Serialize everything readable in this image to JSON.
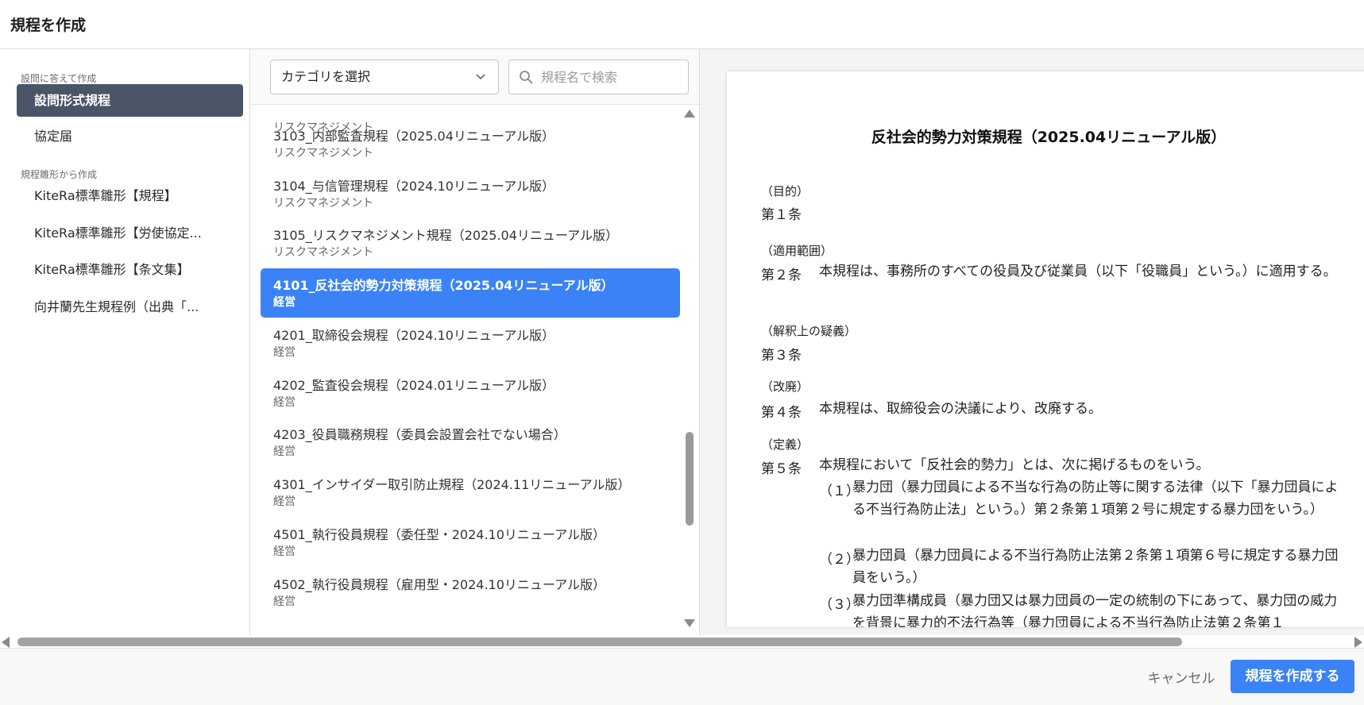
{
  "header": {
    "title": "規程を作成"
  },
  "sidebar": {
    "section_questionnaire": "設問に答えて作成",
    "section_template": "規程雛形から作成",
    "items": [
      {
        "label": "設問形式規程",
        "active": true
      },
      {
        "label": "協定届",
        "active": false
      },
      {
        "label": "KiteRa標準雛形【規程】",
        "active": false
      },
      {
        "label": "KiteRa標準雛形【労使協定...",
        "active": false
      },
      {
        "label": "KiteRa標準雛形【条文集】",
        "active": false
      },
      {
        "label": "向井蘭先生規程例（出典「...",
        "active": false
      }
    ]
  },
  "list": {
    "category_select": "カテゴリを選択",
    "search_placeholder": "規程名で検索",
    "top_partial_category": "リスクマネジメント",
    "rows": [
      {
        "name": "3103_内部監査規程（2025.04リニューアル版）",
        "category": "リスクマネジメント",
        "active": false
      },
      {
        "name": "3104_与信管理規程（2024.10リニューアル版）",
        "category": "リスクマネジメント",
        "active": false
      },
      {
        "name": "3105_リスクマネジメント規程（2025.04リニューアル版）",
        "category": "リスクマネジメント",
        "active": false
      },
      {
        "name": "4101_反社会的勢力対策規程（2025.04リニューアル版）",
        "category": "経営",
        "active": true
      },
      {
        "name": "4201_取締役会規程（2024.10リニューアル版）",
        "category": "経営",
        "active": false
      },
      {
        "name": "4202_監査役会規程（2024.01リニューアル版）",
        "category": "経営",
        "active": false
      },
      {
        "name": "4203_役員職務規程（委員会設置会社でない場合）",
        "category": "経営",
        "active": false
      },
      {
        "name": "4301_インサイダー取引防止規程（2024.11リニューアル版）",
        "category": "経営",
        "active": false
      },
      {
        "name": "4501_執行役員規程（委任型・2024.10リニューアル版）",
        "category": "経営",
        "active": false
      },
      {
        "name": "4502_執行役員規程（雇用型・2024.10リニューアル版）",
        "category": "経営",
        "active": false
      }
    ]
  },
  "preview": {
    "title": "反社会的勢力対策規程（2025.04リニューアル版）",
    "articles": [
      {
        "heading": "（目的）",
        "number": "第１条",
        "body": ""
      },
      {
        "heading": "（適用範囲）",
        "number": "第２条",
        "body": "本規程は、事務所のすべての役員及び従業員（以下「役職員」という。）に適用する。"
      },
      {
        "heading": "（解釈上の疑義）",
        "number": "第３条",
        "body": ""
      },
      {
        "heading": "（改廃）",
        "number": "第４条",
        "body": "本規程は、取締役会の決議により、改廃する。"
      },
      {
        "heading": "（定義）",
        "number": "第５条",
        "body": "本規程において「反社会的勢力」とは、次に掲げるものをいう。"
      }
    ],
    "items": [
      {
        "num": "（１）",
        "text": "暴力団（暴力団員による不当な行為の防止等に関する法律（以下「暴力団員による不当行為防止法」という。）第２条第１項第２号に規定する暴力団をいう。）"
      },
      {
        "num": "（２）",
        "text": "暴力団員（暴力団員による不当行為防止法第２条第１項第６号に規定する暴力団員をいう。）"
      },
      {
        "num": "（３）",
        "text": "暴力団準構成員（暴力団又は暴力団員の一定の統制の下にあって、暴力団の威力を背景に暴力的不法行為等（暴力団員による不当行為防止法第２条第１"
      }
    ]
  },
  "footer": {
    "cancel_label": "キャンセル",
    "create_label": "規程を作成する"
  },
  "colors": {
    "accent": "#3b82f6",
    "sidebar_active": "#4a5568"
  }
}
